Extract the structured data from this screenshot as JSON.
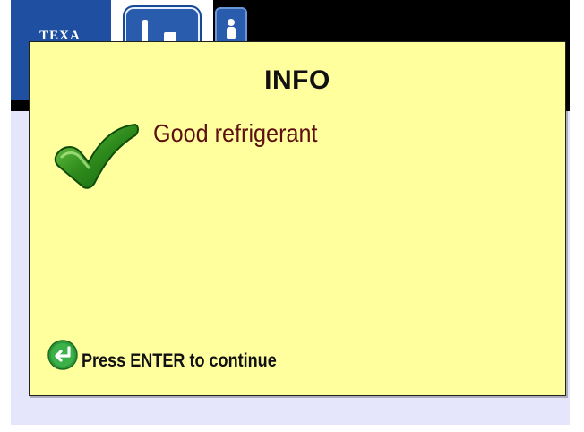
{
  "app": {
    "logo_text": "TEXA"
  },
  "dialog": {
    "title": "INFO",
    "message": "Good refrigerant",
    "enter_hint": "Press ENTER to continue"
  },
  "icons": {
    "status": "checkmark-icon",
    "enter": "enter-arrow-icon",
    "toolbar": [
      "tool-icon",
      "user-icon"
    ]
  },
  "colors": {
    "dialog_background": "#ffff9e",
    "message_text": "#5c1010",
    "check_green": "#2e8b1c",
    "brand_blue": "#1f4fa0",
    "content_background": "#e5e6fb"
  }
}
